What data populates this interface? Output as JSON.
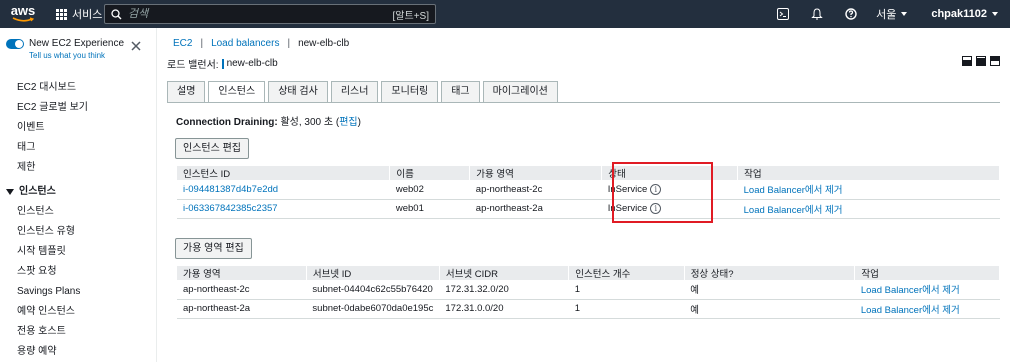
{
  "topbar": {
    "logo_text": "aws",
    "services_label": "서비스",
    "search_placeholder": "검색",
    "search_shortcut": "[알트+S]",
    "region": "서울",
    "user": "chpak1102",
    "icons": [
      "cloudshell-icon",
      "bell-icon",
      "help-icon"
    ]
  },
  "sidebar": {
    "experience_title": "New EC2 Experience",
    "experience_link": "Tell us what you think",
    "items_top": [
      "EC2 대시보드",
      "EC2 글로벌 보기",
      "이벤트",
      "태그",
      "제한"
    ],
    "section_instances": "인스턴스",
    "items_instances": [
      "인스턴스",
      "인스턴스 유형",
      "시작 템플릿",
      "스팟 요청",
      "Savings Plans",
      "예약 인스턴스",
      "전용 호스트",
      "용량 예약"
    ]
  },
  "breadcrumb": {
    "root": "EC2",
    "sep": "|",
    "section": "Load balancers",
    "current": "new-elb-clb"
  },
  "page": {
    "title_label": "로드 밸런서:",
    "title_value": "new-elb-clb"
  },
  "tabs": [
    "설명",
    "인스턴스",
    "상태 검사",
    "리스너",
    "모니터링",
    "태그",
    "마이그레이션"
  ],
  "active_tab": "인스턴스",
  "connection_draining": {
    "label": "Connection Draining:",
    "value": "활성, 300 초",
    "open_paren": "(",
    "edit": "편집",
    "close_paren": ")"
  },
  "instances": {
    "edit_button": "인스턴스 편집",
    "columns": [
      "인스턴스 ID",
      "이름",
      "가용 영역",
      "상태",
      "작업"
    ],
    "rows": [
      {
        "id": "i-094481387d4b7e2dd",
        "name": "web02",
        "az": "ap-northeast-2c",
        "status": "InService",
        "action": "Load Balancer에서 제거"
      },
      {
        "id": "i-063367842385c2357",
        "name": "web01",
        "az": "ap-northeast-2a",
        "status": "InService",
        "action": "Load Balancer에서 제거"
      }
    ]
  },
  "zones": {
    "edit_button": "가용 영역 편집",
    "columns": [
      "가용 영역",
      "서브넷 ID",
      "서브넷 CIDR",
      "인스턴스 개수",
      "정상 상태?",
      "작업"
    ],
    "rows": [
      {
        "az": "ap-northeast-2c",
        "subnet": "subnet-04404c62c55b76420",
        "cidr": "172.31.32.0/20",
        "count": "1",
        "healthy": "예",
        "action": "Load Balancer에서 제거"
      },
      {
        "az": "ap-northeast-2a",
        "subnet": "subnet-0dabe6070da0e195c",
        "cidr": "172.31.0.0/20",
        "count": "1",
        "healthy": "예",
        "action": "Load Balancer에서 제거"
      }
    ]
  },
  "colors": {
    "nav_bg": "#232f3e",
    "link": "#0073bb",
    "highlight": "#e01b24",
    "aws_smile": "#ff9900"
  }
}
